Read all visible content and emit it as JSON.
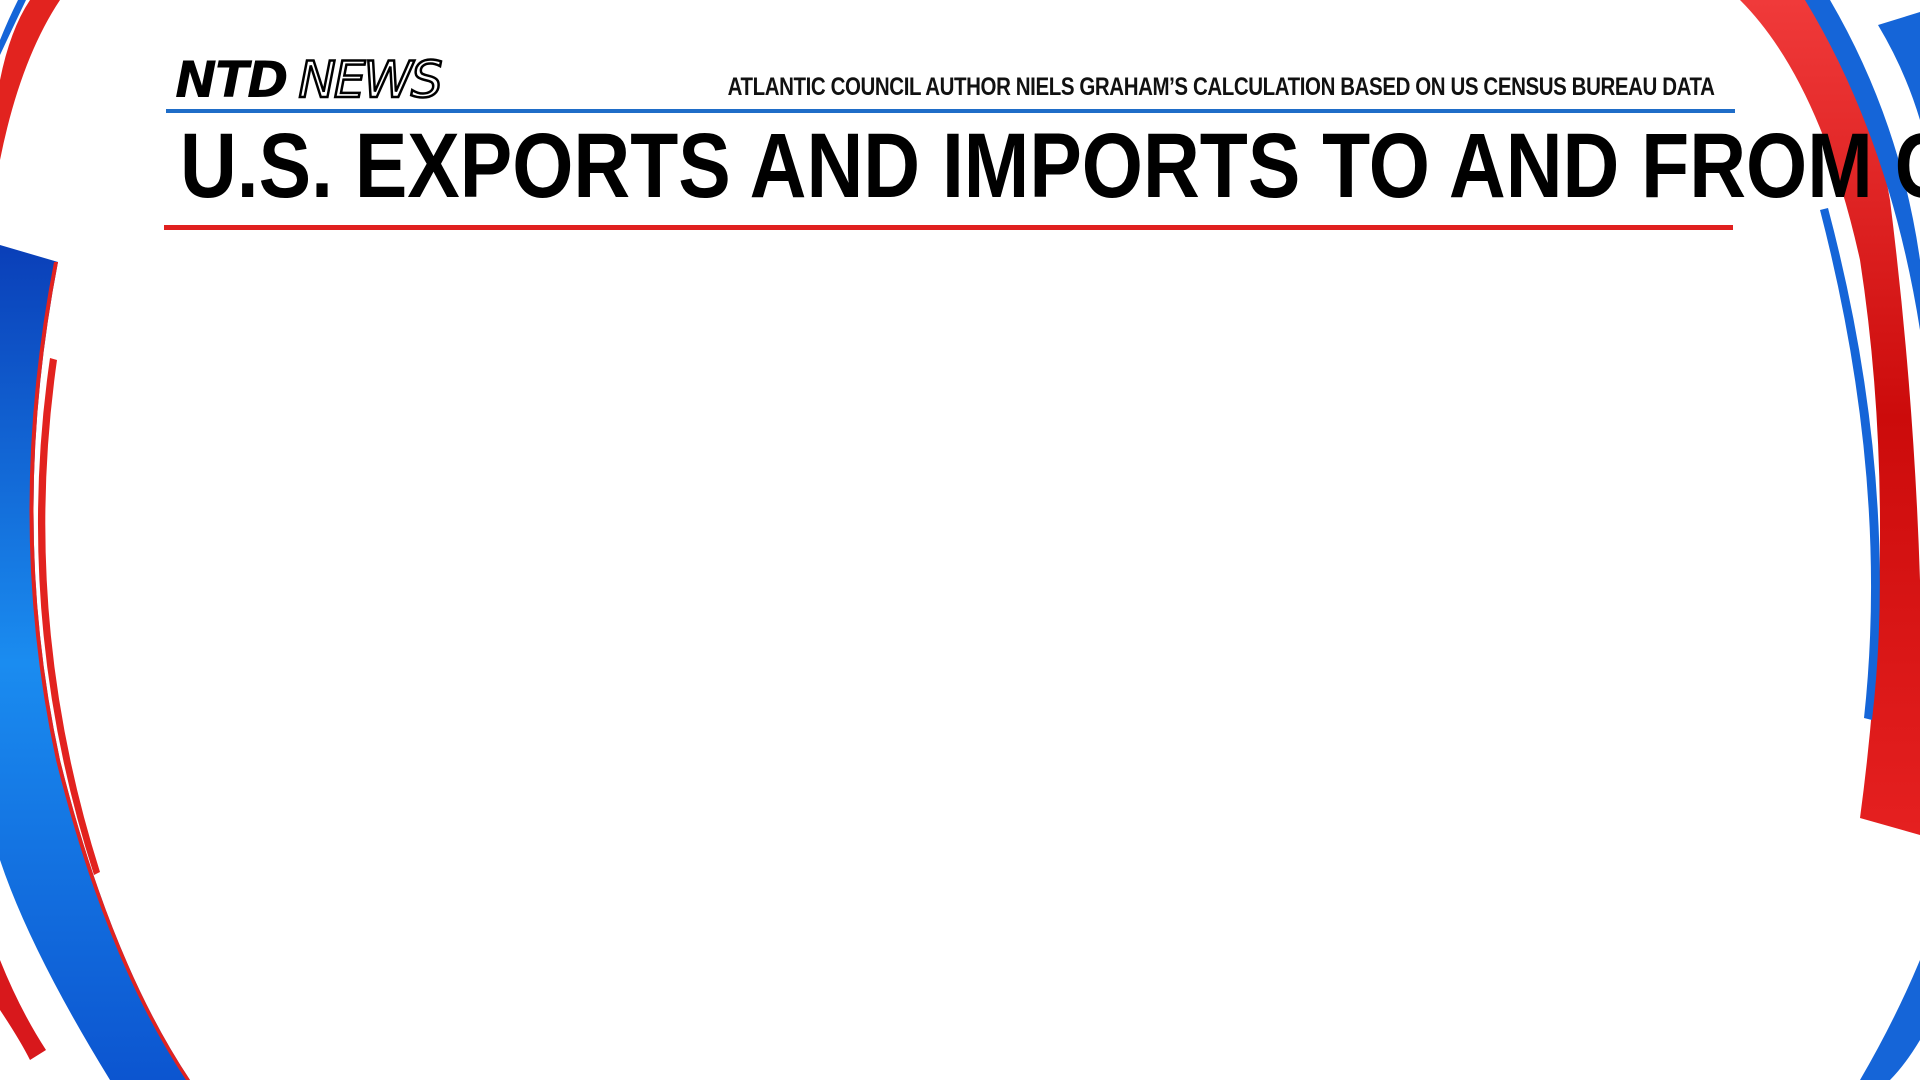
{
  "branding": {
    "logo_ntd": "NTD",
    "logo_news": "NEWS"
  },
  "header": {
    "source": "ATLANTIC COUNCIL AUTHOR NIELS GRAHAM’S CALCULATION BASED ON US CENSUS BUREAU DATA",
    "title": "U.S. EXPORTS AND IMPORTS TO AND FROM CHINA"
  },
  "colors": {
    "accent_blue": "#1f6dc8",
    "accent_red": "#e0201f",
    "text": "#000000",
    "background": "#ffffff"
  }
}
